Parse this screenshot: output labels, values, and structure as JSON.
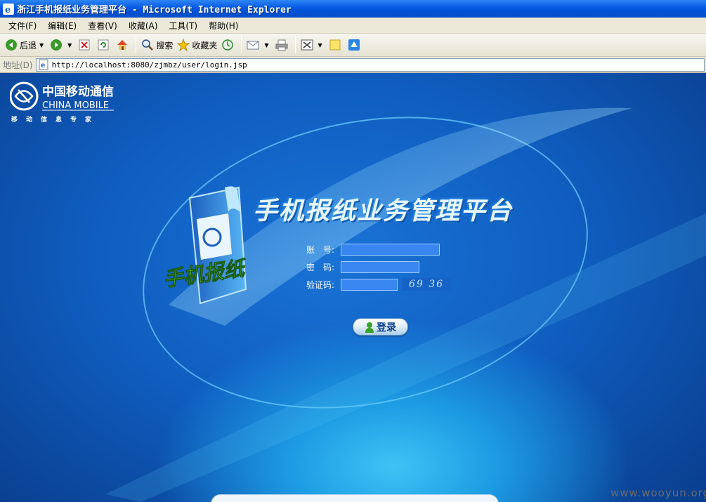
{
  "window": {
    "title": "浙江手机报纸业务管理平台 - Microsoft Internet Explorer"
  },
  "menu": [
    "文件(F)",
    "编辑(E)",
    "查看(V)",
    "收藏(A)",
    "工具(T)",
    "帮助(H)"
  ],
  "toolbar": {
    "back_label": "后退",
    "search_label": "搜索",
    "favorites_label": "收藏夹"
  },
  "address": {
    "label": "地址(D)",
    "url": "http://localhost:8080/zjmbz/user/login.jsp"
  },
  "logo": {
    "cn": "中国移动通信",
    "en": "CHINA MOBILE",
    "slogan": "移动信息专家"
  },
  "app": {
    "title": "手机报纸业务管理平台",
    "icon_text": "手机报纸"
  },
  "form": {
    "account_label": "账　号:",
    "account_value": "",
    "password_label": "密　码:",
    "password_value": "",
    "captcha_label": "验证码:",
    "captcha_value": "",
    "captcha_image_text": "69 36",
    "login_label": "登录"
  },
  "watermark": "www.wooyun.org",
  "colors": {
    "titlebar": "#0a5ee6",
    "content_bg": "#0f5dbf",
    "input_bg": "#3a86f0",
    "accent": "#3ec3f5"
  }
}
